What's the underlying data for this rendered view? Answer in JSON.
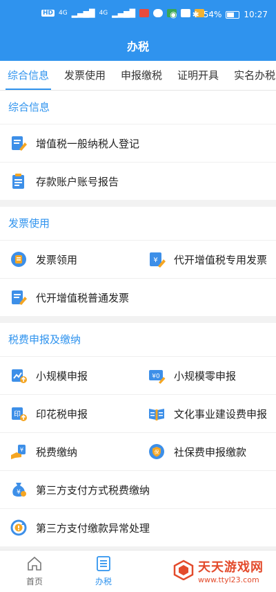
{
  "status_bar": {
    "network_left": "HD",
    "signal_4g_a": "4G",
    "signal_4g_b": "4G",
    "battery": "54%",
    "time": "10:27",
    "more": "···"
  },
  "header": {
    "title": "办税"
  },
  "tabs": [
    {
      "label": "综合信息",
      "active": true
    },
    {
      "label": "发票使用"
    },
    {
      "label": "申报缴税"
    },
    {
      "label": "证明开具"
    },
    {
      "label": "实名办税"
    }
  ],
  "sections": [
    {
      "title": "综合信息",
      "items": [
        {
          "label": "增值税一般纳税人登记",
          "icon": "pen-document-icon"
        },
        {
          "label": "存款账户账号报告",
          "icon": "clipboard-icon"
        }
      ]
    },
    {
      "title": "发票使用",
      "items": [
        {
          "label": "发票领用",
          "icon": "invoice-coin-icon"
        },
        {
          "label": "代开增值税专用发票",
          "icon": "receipt-pen-icon"
        },
        {
          "label": "代开增值税普通发票",
          "icon": "pen-document-icon"
        }
      ]
    },
    {
      "title": "税费申报及缴纳",
      "items": [
        {
          "label": "小规模申报",
          "icon": "chart-upload-icon"
        },
        {
          "label": "小规模零申报",
          "icon": "yen-zero-icon"
        },
        {
          "label": "印花税申报",
          "icon": "stamp-tax-icon"
        },
        {
          "label": "文化事业建设费申报",
          "icon": "open-book-icon"
        },
        {
          "label": "税费缴纳",
          "icon": "hand-pay-icon"
        },
        {
          "label": "社保费申报缴款",
          "icon": "shield-badge-icon"
        },
        {
          "label": "第三方支付方式税费缴纳",
          "icon": "money-bag-icon"
        },
        {
          "label": "第三方支付缴款异常处理",
          "icon": "refresh-alert-icon"
        }
      ]
    }
  ],
  "bottom_nav": [
    {
      "label": "首页",
      "icon": "home-icon"
    },
    {
      "label": "办税",
      "icon": "list-icon",
      "active": true
    }
  ],
  "watermark": {
    "main": "天天游戏网",
    "url": "www.ttyl23.com"
  },
  "colors": {
    "primary": "#2f93ee",
    "accent_orange": "#f5a623",
    "watermark": "#e34b2c"
  }
}
